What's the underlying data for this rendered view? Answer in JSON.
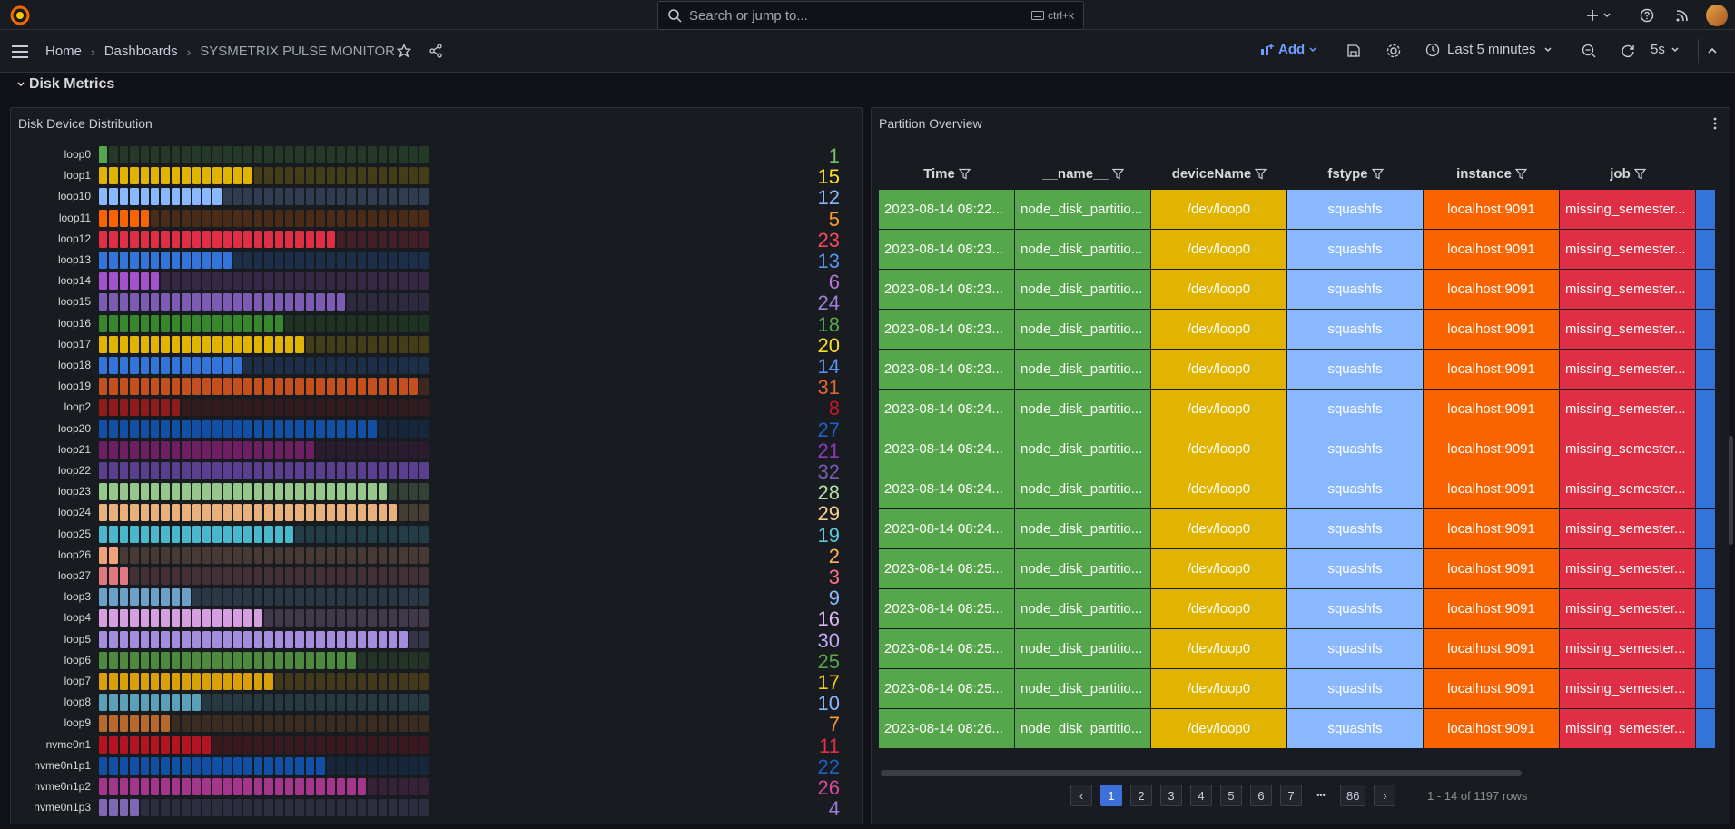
{
  "topbar": {
    "search_placeholder": "Search or jump to...",
    "search_shortcut": "ctrl+k",
    "icons": [
      "grafana-logo",
      "plus-icon",
      "chevron-down-icon",
      "help-icon",
      "news-icon",
      "user-avatar"
    ]
  },
  "navbar": {
    "breadcrumb": [
      "Home",
      "Dashboards",
      "SYSMETRIX PULSE MONITOR"
    ],
    "add_label": "Add",
    "time_range": "Last 5 minutes",
    "refresh_interval": "5s"
  },
  "row": {
    "title": "Disk Metrics"
  },
  "bargauge": {
    "title": "Disk Device Distribution",
    "max_cells": 32,
    "items": [
      {
        "label": "loop0",
        "value": "1",
        "n": 1,
        "color": "#56a64b",
        "text": "#73bf69"
      },
      {
        "label": "loop1",
        "value": "15",
        "n": 15,
        "color": "#e0b400",
        "text": "#fade2a"
      },
      {
        "label": "loop10",
        "value": "12",
        "n": 12,
        "color": "#8ab8ff",
        "text": "#8ab8ff"
      },
      {
        "label": "loop11",
        "value": "5",
        "n": 5,
        "color": "#fa6400",
        "text": "#ff9830"
      },
      {
        "label": "loop12",
        "value": "23",
        "n": 23,
        "color": "#e02f44",
        "text": "#f2495c"
      },
      {
        "label": "loop13",
        "value": "13",
        "n": 13,
        "color": "#3274d9",
        "text": "#5794f2"
      },
      {
        "label": "loop14",
        "value": "6",
        "n": 6,
        "color": "#a352cc",
        "text": "#b877d9"
      },
      {
        "label": "loop15",
        "value": "24",
        "n": 24,
        "color": "#7c5cb3",
        "text": "#9f7fd9"
      },
      {
        "label": "loop16",
        "value": "18",
        "n": 18,
        "color": "#37872d",
        "text": "#56a64b"
      },
      {
        "label": "loop17",
        "value": "20",
        "n": 20,
        "color": "#e0b400",
        "text": "#fade2a"
      },
      {
        "label": "loop18",
        "value": "14",
        "n": 14,
        "color": "#3274d9",
        "text": "#5794f2"
      },
      {
        "label": "loop19",
        "value": "31",
        "n": 31,
        "color": "#c4501d",
        "text": "#e0662f"
      },
      {
        "label": "loop2",
        "value": "8",
        "n": 8,
        "color": "#8f1b1b",
        "text": "#c4162a"
      },
      {
        "label": "loop20",
        "value": "27",
        "n": 27,
        "color": "#1250a6",
        "text": "#1f60c4"
      },
      {
        "label": "loop21",
        "value": "21",
        "n": 21,
        "color": "#6d1f62",
        "text": "#8f3bb8"
      },
      {
        "label": "loop22",
        "value": "32",
        "n": 32,
        "color": "#5b3f8f",
        "text": "#7c5cb3"
      },
      {
        "label": "loop23",
        "value": "28",
        "n": 28,
        "color": "#96c78a",
        "text": "#b3dfa6"
      },
      {
        "label": "loop24",
        "value": "29",
        "n": 29,
        "color": "#e8b07a",
        "text": "#fad192"
      },
      {
        "label": "loop25",
        "value": "19",
        "n": 19,
        "color": "#4ab8cc",
        "text": "#5cc9db"
      },
      {
        "label": "loop26",
        "value": "2",
        "n": 2,
        "color": "#f2a27a",
        "text": "#ffb357"
      },
      {
        "label": "loop27",
        "value": "3",
        "n": 3,
        "color": "#e07a80",
        "text": "#ff7383"
      },
      {
        "label": "loop3",
        "value": "9",
        "n": 9,
        "color": "#6ba1c9",
        "text": "#8ab8ff"
      },
      {
        "label": "loop4",
        "value": "16",
        "n": 16,
        "color": "#d59fe0",
        "text": "#deb6f2"
      },
      {
        "label": "loop5",
        "value": "30",
        "n": 30,
        "color": "#a48ddc",
        "text": "#c0a8f0"
      },
      {
        "label": "loop6",
        "value": "25",
        "n": 25,
        "color": "#4d8a3e",
        "text": "#56a64b"
      },
      {
        "label": "loop7",
        "value": "17",
        "n": 17,
        "color": "#d9a007",
        "text": "#f2cc0c"
      },
      {
        "label": "loop8",
        "value": "10",
        "n": 10,
        "color": "#5aa0b8",
        "text": "#8ab8ff"
      },
      {
        "label": "loop9",
        "value": "7",
        "n": 7,
        "color": "#b8682a",
        "text": "#ff9830"
      },
      {
        "label": "nvme0n1",
        "value": "11",
        "n": 11,
        "color": "#b3141f",
        "text": "#e02f44"
      },
      {
        "label": "nvme0n1p1",
        "value": "22",
        "n": 22,
        "color": "#1250a6",
        "text": "#1f60c4"
      },
      {
        "label": "nvme0n1p2",
        "value": "26",
        "n": 26,
        "color": "#a3358a",
        "text": "#d44a9e"
      },
      {
        "label": "nvme0n1p3",
        "value": "4",
        "n": 4,
        "color": "#7f68b3",
        "text": "#9f7fd9"
      }
    ]
  },
  "table": {
    "title": "Partition Overview",
    "columns": [
      "Time",
      "__name__",
      "deviceName",
      "fstype",
      "instance",
      "job"
    ],
    "rows": [
      [
        "2023-08-14 08:22...",
        "node_disk_partitio...",
        "/dev/loop0",
        "squashfs",
        "localhost:9091",
        "missing_semester..."
      ],
      [
        "2023-08-14 08:23...",
        "node_disk_partitio...",
        "/dev/loop0",
        "squashfs",
        "localhost:9091",
        "missing_semester..."
      ],
      [
        "2023-08-14 08:23...",
        "node_disk_partitio...",
        "/dev/loop0",
        "squashfs",
        "localhost:9091",
        "missing_semester..."
      ],
      [
        "2023-08-14 08:23...",
        "node_disk_partitio...",
        "/dev/loop0",
        "squashfs",
        "localhost:9091",
        "missing_semester..."
      ],
      [
        "2023-08-14 08:23...",
        "node_disk_partitio...",
        "/dev/loop0",
        "squashfs",
        "localhost:9091",
        "missing_semester..."
      ],
      [
        "2023-08-14 08:24...",
        "node_disk_partitio...",
        "/dev/loop0",
        "squashfs",
        "localhost:9091",
        "missing_semester..."
      ],
      [
        "2023-08-14 08:24...",
        "node_disk_partitio...",
        "/dev/loop0",
        "squashfs",
        "localhost:9091",
        "missing_semester..."
      ],
      [
        "2023-08-14 08:24...",
        "node_disk_partitio...",
        "/dev/loop0",
        "squashfs",
        "localhost:9091",
        "missing_semester..."
      ],
      [
        "2023-08-14 08:24...",
        "node_disk_partitio...",
        "/dev/loop0",
        "squashfs",
        "localhost:9091",
        "missing_semester..."
      ],
      [
        "2023-08-14 08:25...",
        "node_disk_partitio...",
        "/dev/loop0",
        "squashfs",
        "localhost:9091",
        "missing_semester..."
      ],
      [
        "2023-08-14 08:25...",
        "node_disk_partitio...",
        "/dev/loop0",
        "squashfs",
        "localhost:9091",
        "missing_semester..."
      ],
      [
        "2023-08-14 08:25...",
        "node_disk_partitio...",
        "/dev/loop0",
        "squashfs",
        "localhost:9091",
        "missing_semester..."
      ],
      [
        "2023-08-14 08:25...",
        "node_disk_partitio...",
        "/dev/loop0",
        "squashfs",
        "localhost:9091",
        "missing_semester..."
      ],
      [
        "2023-08-14 08:26...",
        "node_disk_partitio...",
        "/dev/loop0",
        "squashfs",
        "localhost:9091",
        "missing_semester..."
      ]
    ],
    "pagination": {
      "pages": [
        "1",
        "2",
        "3",
        "4",
        "5",
        "6",
        "7",
        "...",
        "86"
      ],
      "current": "1",
      "info": "1 - 14 of 1197 rows"
    }
  }
}
